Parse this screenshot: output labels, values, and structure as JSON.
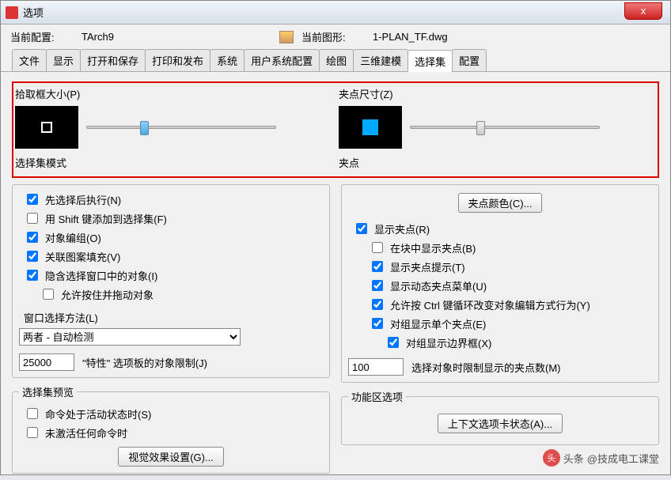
{
  "window": {
    "title": "选项"
  },
  "close_x": "x",
  "config": {
    "current_profile_label": "当前配置:",
    "current_profile_value": "TArch9",
    "current_drawing_label": "当前图形:",
    "current_drawing_value": "1-PLAN_TF.dwg"
  },
  "tabs": [
    "文件",
    "显示",
    "打开和保存",
    "打印和发布",
    "系统",
    "用户系统配置",
    "绘图",
    "三维建模",
    "选择集",
    "配置"
  ],
  "active_tab": 8,
  "left": {
    "pickbox_size_label": "拾取框大小(P)",
    "selmode_label": "选择集模式",
    "chk_pickfirst": "先选择后执行(N)",
    "chk_shift": "用 Shift 键添加到选择集(F)",
    "chk_group": "对象编组(O)",
    "chk_hatch": "关联图案填充(V)",
    "chk_implied": "隐含选择窗口中的对象(I)",
    "chk_drag": "允许按住并拖动对象",
    "window_method_label": "窗口选择方法(L)",
    "window_method_value": "两者 - 自动检测",
    "prop_limit_value": "25000",
    "prop_limit_label": "\"特性\" 选项板的对象限制(J)",
    "preview_label": "选择集预览",
    "chk_active": "命令处于活动状态时(S)",
    "chk_noactive": "未激活任何命令时",
    "btn_visual": "视觉效果设置(G)..."
  },
  "right": {
    "grip_size_label": "夹点尺寸(Z)",
    "grips_label": "夹点",
    "btn_gripcolor": "夹点颜色(C)...",
    "chk_showgrips": "显示夹点(R)",
    "chk_blockgrips": "在块中显示夹点(B)",
    "chk_griptips": "显示夹点提示(T)",
    "chk_dyngripmenu": "显示动态夹点菜单(U)",
    "chk_ctrl": "允许按 Ctrl 键循环改变对象编辑方式行为(Y)",
    "chk_grouponegrip": "对组显示单个夹点(E)",
    "chk_groupbbox": "对组显示边界框(X)",
    "griplimit_value": "100",
    "griplimit_label": "选择对象时限制显示的夹点数(M)",
    "ribbon_label": "功能区选项",
    "btn_context": "上下文选项卡状态(A)..."
  },
  "watermark": {
    "prefix": "头条",
    "text": "@技成电工课堂"
  }
}
